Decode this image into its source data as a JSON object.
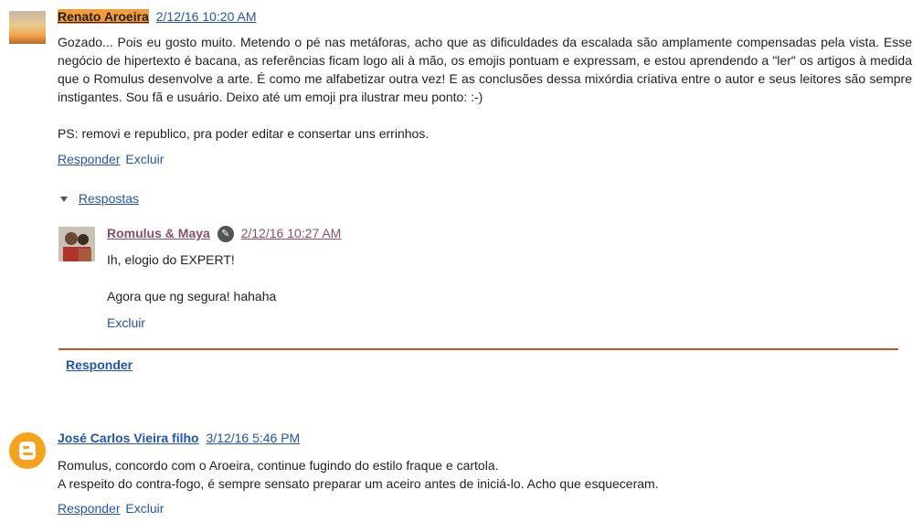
{
  "comment1": {
    "author": "Renato Aroeira",
    "date": "2/12/16 10:20 AM",
    "body_p1": "Gozado... Pois eu gosto muito. Metendo o pé nas metáforas, acho que as dificuldades da escalada são amplamente compensadas pela vista. Esse negócio de hipertexto é bacana, as referências ficam logo ali à mão, os emojis pontuam e expressam, e estou aprendendo a \"ler\" os artigos à medida que o Romulus desenvolve a arte. É como me alfabetizar outra vez! E as conclusões dessa mixórdia criativa entre o autor e seus leitores são sempre instigantes. Sou fã e usuário. Deixo até um emoji pra ilustrar meu ponto: :-)",
    "body_p2": "PS: removi e republico, pra poder editar e consertar uns errinhos.",
    "reply_label": "Responder",
    "delete_label": "Excluir",
    "replies_toggle_label": "Respostas",
    "replies_toggle_icon": "triangle-down",
    "avatar_icon": "sunset-photo",
    "reply": {
      "author": "Romulus & Maya",
      "author_badge_icon": "pencil-icon",
      "date": "2/12/16 10:27 AM",
      "body_p1": "Ih, elogio do EXPERT!",
      "body_p2": "Agora que ng segura! hahaha",
      "delete_label": "Excluir",
      "avatar_icon": "people-photo"
    },
    "thread_reply_label": "Responder"
  },
  "comment2": {
    "author": "José Carlos Vieira filho",
    "date": "3/12/16 5:46 PM",
    "body_line1": "Romulus, concordo com o Aroeira, continue fugindo do estilo fraque e cartola.",
    "body_line2": "A respeito do contra-fogo, é sempre sensato preparar um aceiro antes de iniciá-lo. Acho que esqueceram.",
    "reply_label": "Responder",
    "delete_label": "Excluir",
    "avatar_icon": "blogger-icon"
  },
  "colors": {
    "link": "#2255aa",
    "author_highlight": "#f39c3a",
    "reply_author": "#8a4d6e",
    "thread_rule": "#c9522a",
    "blogger_orange": "#f5a21c"
  }
}
